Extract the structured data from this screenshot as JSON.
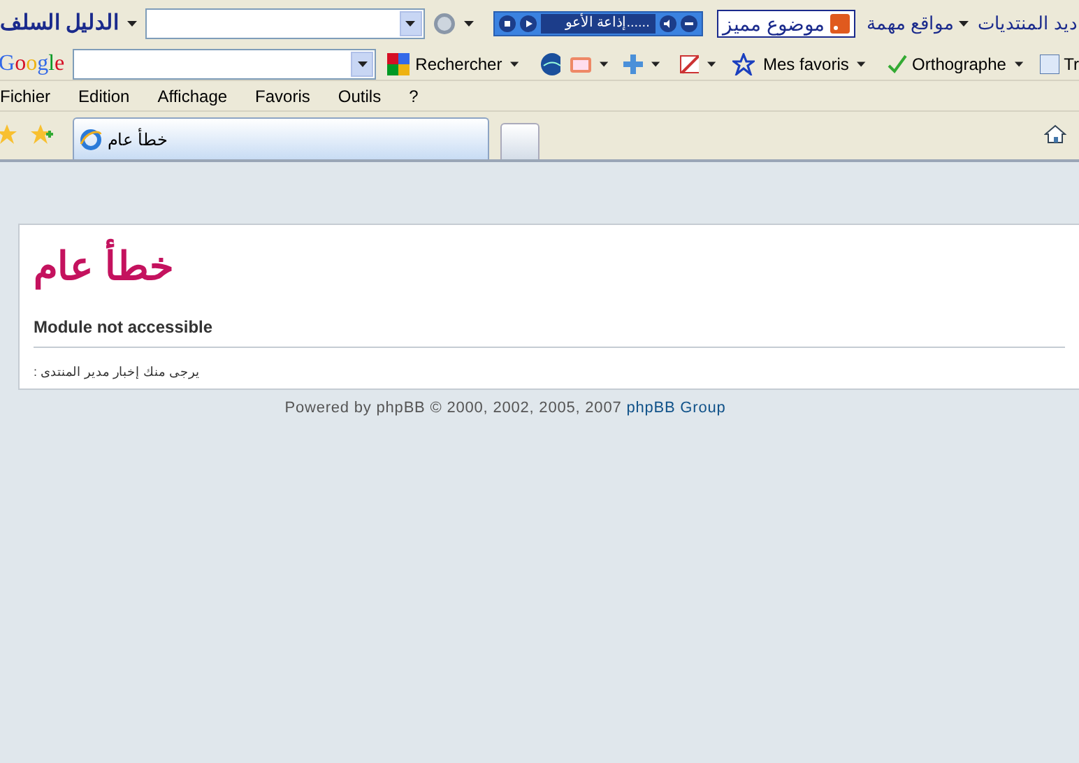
{
  "toolbar_top": {
    "site_name": "الدليل السلف",
    "radio_label": "إذاعة الأعو......",
    "featured": "موضوع مميز",
    "links": [
      "ديد المنتديات",
      "مواقع مهمة"
    ]
  },
  "toolbar_google": {
    "logo": "Google",
    "search_button": "Rechercher",
    "favorites": "Mes favoris",
    "spelling": "Orthographe",
    "translate": "Tr"
  },
  "menu": {
    "file": "Fichier",
    "edit": "Edition",
    "view": "Affichage",
    "favorites": "Favoris",
    "tools": "Outils",
    "help": "?"
  },
  "tabs": [
    {
      "label": "خطأ عام",
      "selected": true
    }
  ],
  "error": {
    "title": "خطأ عام",
    "heading": "Module not accessible",
    "message": "يرجى منك إخبار مدير المنتدى :"
  },
  "footer": {
    "text": "Powered by phpBB © 2000, 2002, 2005, 2007",
    "link": "phpBB Group"
  }
}
